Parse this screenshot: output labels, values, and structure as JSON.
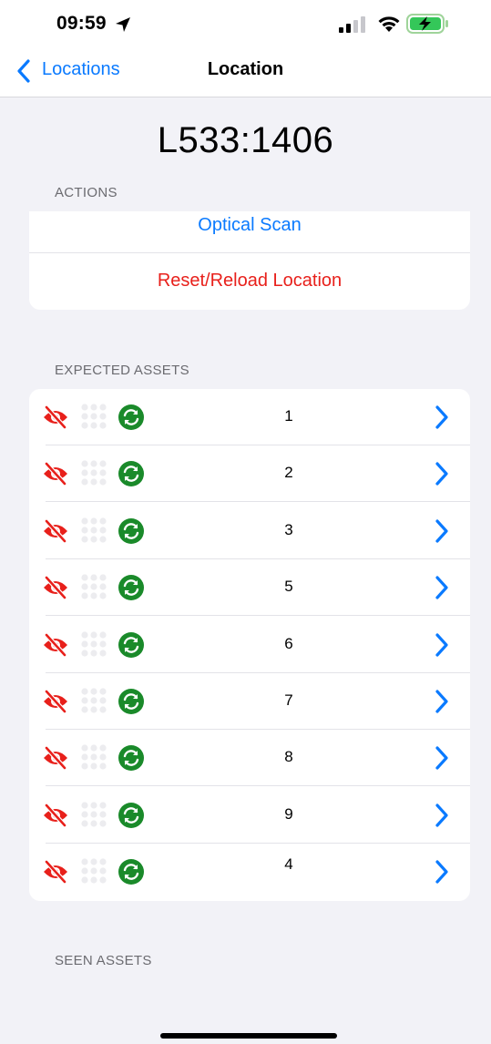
{
  "status_bar": {
    "time": "09:59"
  },
  "nav": {
    "back_label": "Locations",
    "title": "Location"
  },
  "location_id": "L533:1406",
  "actions": {
    "header": "ACTIONS",
    "items": [
      {
        "label": "Optical Scan",
        "color": "#0a7aff"
      },
      {
        "label": "Reset/Reload Location",
        "color": "#e8201b"
      }
    ]
  },
  "expected_assets": {
    "header": "EXPECTED ASSETS",
    "items": [
      {
        "number": "1",
        "icons": [
          "eye-slash-icon",
          "dots-grid-icon",
          "sync-icon",
          "chevron-right-icon"
        ]
      },
      {
        "number": "2",
        "icons": [
          "eye-slash-icon",
          "dots-grid-icon",
          "sync-icon",
          "chevron-right-icon"
        ]
      },
      {
        "number": "3",
        "icons": [
          "eye-slash-icon",
          "dots-grid-icon",
          "sync-icon",
          "chevron-right-icon"
        ]
      },
      {
        "number": "5",
        "icons": [
          "eye-slash-icon",
          "dots-grid-icon",
          "sync-icon",
          "chevron-right-icon"
        ]
      },
      {
        "number": "6",
        "icons": [
          "eye-slash-icon",
          "dots-grid-icon",
          "sync-icon",
          "chevron-right-icon"
        ]
      },
      {
        "number": "7",
        "icons": [
          "eye-slash-icon",
          "dots-grid-icon",
          "sync-icon",
          "chevron-right-icon"
        ]
      },
      {
        "number": "8",
        "icons": [
          "eye-slash-icon",
          "dots-grid-icon",
          "sync-icon",
          "chevron-right-icon"
        ]
      },
      {
        "number": "9",
        "icons": [
          "eye-slash-icon",
          "dots-grid-icon",
          "sync-icon",
          "chevron-right-icon"
        ]
      },
      {
        "number": "4",
        "icons": [
          "eye-slash-icon",
          "dots-grid-icon",
          "sync-icon",
          "chevron-right-icon"
        ]
      }
    ]
  },
  "seen_assets": {
    "header": "SEEN ASSETS"
  },
  "colors": {
    "accent": "#0a7aff",
    "destructive": "#e8201b",
    "sync_green": "#1a8a2a",
    "background": "#f2f2f7"
  }
}
